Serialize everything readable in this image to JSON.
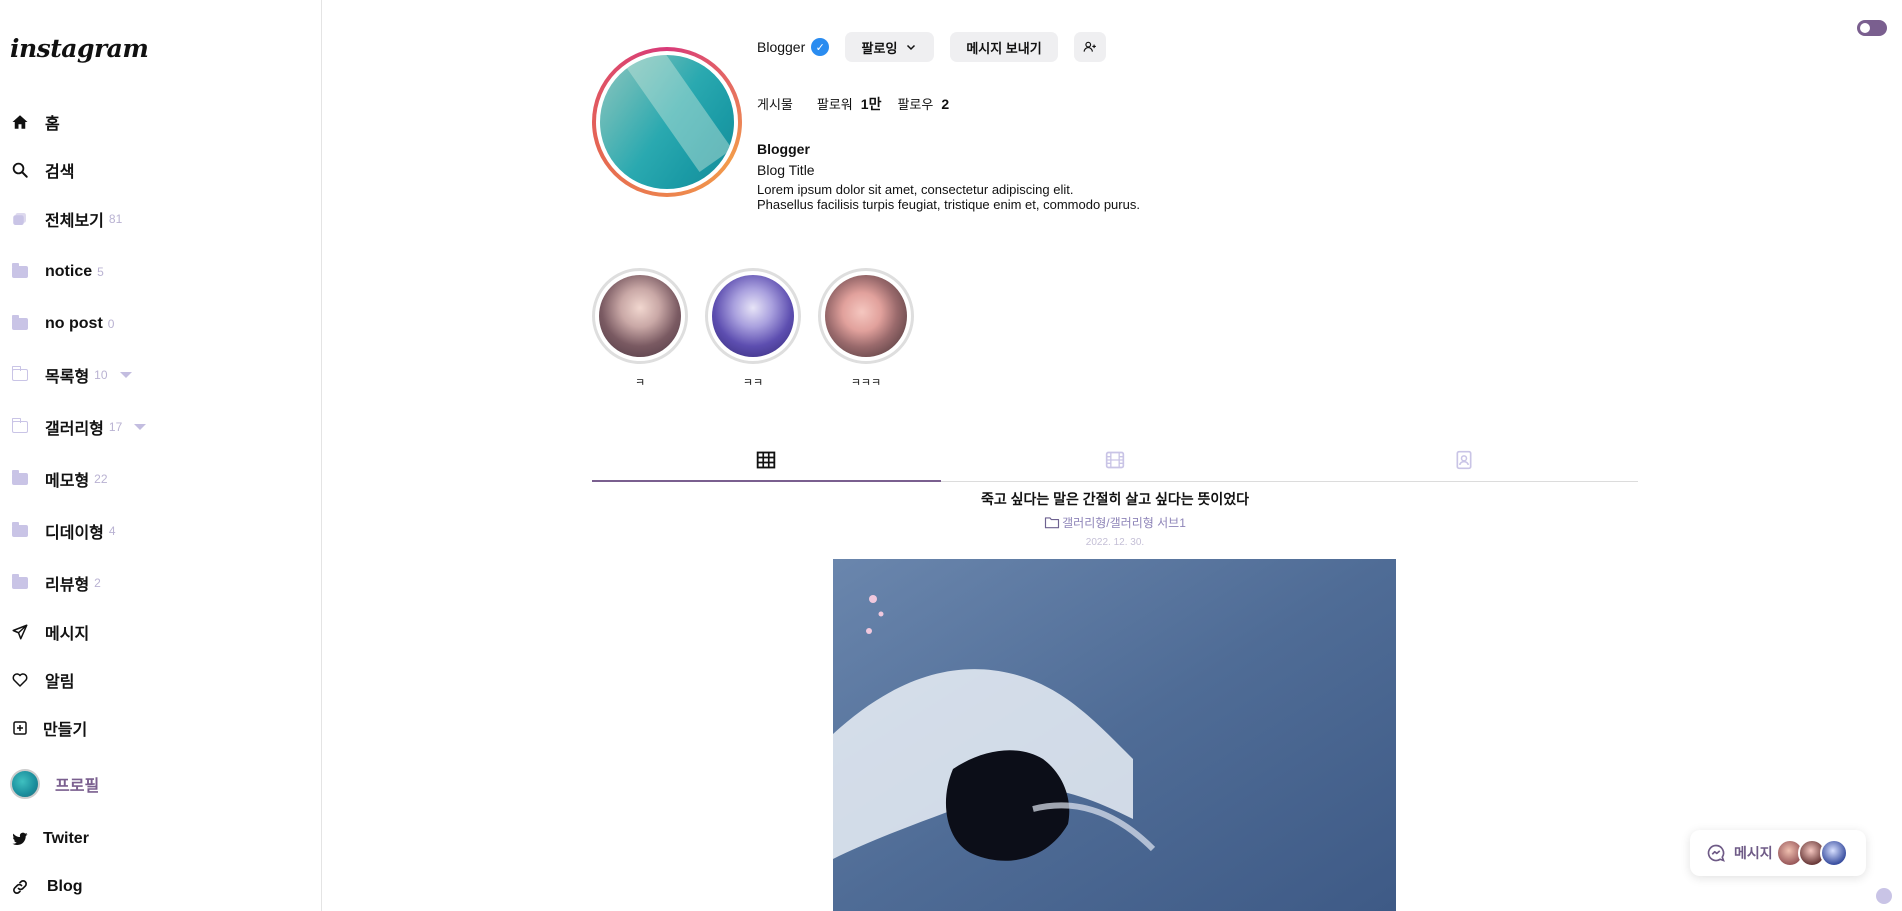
{
  "sidebar": {
    "logo": "instagram",
    "nav": [
      {
        "label": "홈",
        "icon": "home-icon"
      },
      {
        "label": "검색",
        "icon": "search-icon"
      }
    ],
    "categories": [
      {
        "label": "전체보기",
        "count": "81"
      },
      {
        "label": "notice",
        "count": "5"
      },
      {
        "label": "no post",
        "count": "0"
      },
      {
        "label": "목록형",
        "count": "10"
      },
      {
        "label": "갤러리형",
        "count": "17"
      },
      {
        "label": "메모형",
        "count": "22"
      },
      {
        "label": "디데이형",
        "count": "4"
      },
      {
        "label": "리뷰형",
        "count": "2"
      }
    ],
    "actions": [
      {
        "label": "메시지"
      },
      {
        "label": "알림"
      },
      {
        "label": "만들기"
      }
    ],
    "profile_label": "프로필",
    "links": [
      {
        "label": "Twiter"
      },
      {
        "label": "Blog"
      }
    ]
  },
  "profile": {
    "username": "Blogger",
    "verified_mark": "✓",
    "following_button": "팔로잉",
    "message_button": "메시지 보내기",
    "stats": {
      "posts_label": "게시물",
      "followers_label": "팔로워",
      "followers_value": "1만",
      "following_label": "팔로우",
      "following_value": "2"
    },
    "bio_name": "Blogger",
    "bio_title": "Blog Title",
    "bio_line1": "Lorem ipsum dolor sit amet, consectetur adipiscing elit.",
    "bio_line2": "Phasellus facilisis turpis feugiat, tristique enim et, commodo purus."
  },
  "highlights": [
    {
      "label": "ㅋ"
    },
    {
      "label": "ㅋㅋ"
    },
    {
      "label": "ㅋㅋㅋ"
    }
  ],
  "post": {
    "title": "죽고 싶다는 말은 간절히 살고 싶다는 뜻이었다",
    "category": "갤러리형/갤러리형 서브1",
    "date": "2022. 12. 30."
  },
  "message_widget": {
    "label": "메시지"
  },
  "colors": {
    "accent": "#7a5f8f",
    "category_count": "#b9b2d2",
    "verified": "#2a8cf0"
  }
}
